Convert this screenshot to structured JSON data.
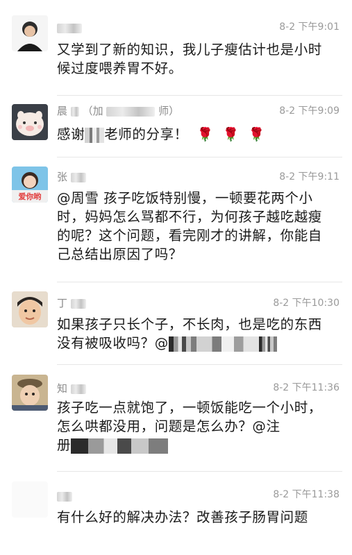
{
  "comments": [
    {
      "name": "",
      "time": "8-2 下午9:01",
      "text_parts": [
        "又学到了新的知识，我儿子瘦估计也是小时候过度喂养胃不好。"
      ]
    },
    {
      "name": "晨",
      "name_suffix": "（加",
      "name_tail": "师）",
      "time": "8-2 下午9:09",
      "text_before": "感谢",
      "text_after": "老师的分享！",
      "roses": [
        "🌹",
        "🌹",
        "🌹"
      ]
    },
    {
      "name": "张",
      "time": "8-2 下午9:11",
      "text_parts": [
        "@周雪 孩子吃饭特别慢，一顿要花两个小时，妈妈怎么骂都不行，为何孩子越吃越瘦的呢？这个问题，看完刚才的讲解，你能自己总结出原因了吗？"
      ]
    },
    {
      "name": "丁",
      "time": "8-2 下午10:30",
      "text_before": "如果孩子只长个子，不长肉，也是吃的东西没有被吸收吗？@"
    },
    {
      "name": "知",
      "time": "8-2 下午11:36",
      "text_before": "孩子吃一点就饱了，一顿饭能吃一个小时，怎么哄都没用，问题是怎么办？@注",
      "text_after": "册"
    },
    {
      "name": "",
      "time": "8-2 下午11:38",
      "text_parts": [
        "有什么好的解决办法？改善孩子肠胃问题"
      ]
    }
  ]
}
